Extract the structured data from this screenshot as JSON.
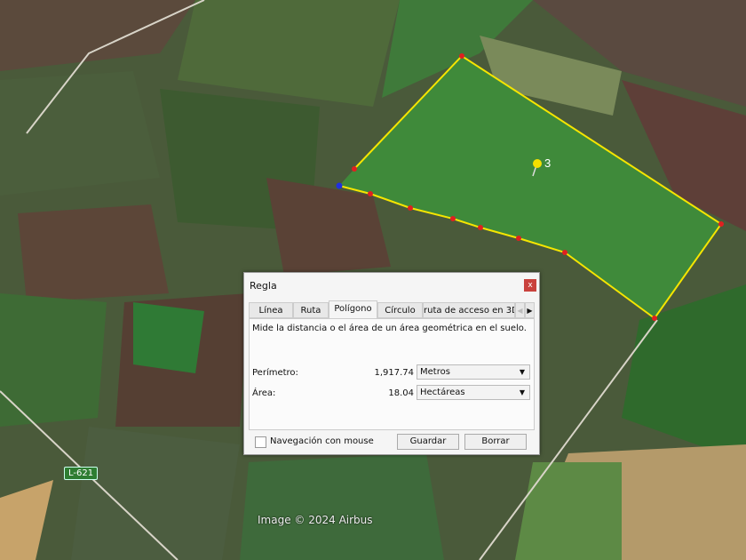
{
  "map": {
    "road_label": "L-621",
    "attribution": "Image © 2024 Airbus",
    "placemark_label": "3",
    "polygon_color": "#f5e500"
  },
  "dialog": {
    "title": "Regla",
    "close_label": "x",
    "tabs": [
      {
        "label": "Línea"
      },
      {
        "label": "Ruta"
      },
      {
        "label": "Polígono",
        "active": true
      },
      {
        "label": "Círculo"
      },
      {
        "label": "ruta de acceso en 3D"
      }
    ],
    "description": "Mide la distancia o el área de un área geométrica en el suelo.",
    "perimeter": {
      "label": "Perímetro:",
      "value": "1,917.74",
      "unit": "Metros"
    },
    "area": {
      "label": "Área:",
      "value": "18.04",
      "unit": "Hectáreas"
    },
    "mouse_nav_label": "Navegación con mouse",
    "mouse_nav_checked": false,
    "save_label": "Guardar",
    "clear_label": "Borrar"
  }
}
